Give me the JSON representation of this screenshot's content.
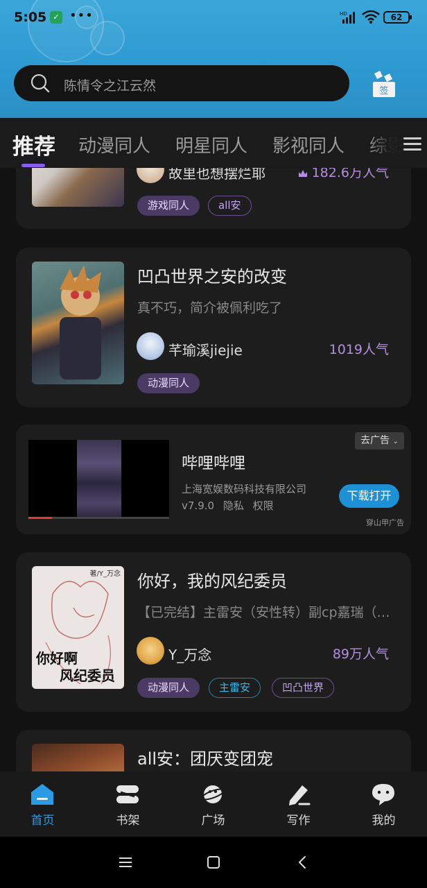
{
  "status_bar": {
    "time": "5:05",
    "dots": "•••",
    "battery": "62",
    "network": "HD"
  },
  "search": {
    "placeholder": "陈情令之江云然"
  },
  "signin": {
    "label": "签"
  },
  "tabs": [
    {
      "label": "推荐"
    },
    {
      "label": "动漫同人"
    },
    {
      "label": "明星同人"
    },
    {
      "label": "影视同人"
    },
    {
      "label": "综影"
    }
  ],
  "cards": [
    {
      "author": "故里也想摆烂耶",
      "popularity": "182.6万人气",
      "tags": [
        "游戏同人",
        "all安"
      ]
    },
    {
      "title": "凹凸世界之安的改变",
      "desc": "真不巧，简介被佩利吃了",
      "author": "芊瑜溪jiejie",
      "popularity": "1019人气",
      "tags": [
        "动漫同人"
      ]
    },
    {
      "title": "你好，我的风纪委员",
      "desc": "【已完结】主雷安（安性转）副cp嘉瑞（瑞…",
      "author": "Y_万念",
      "popularity": "89万人气",
      "tags": [
        "动漫同人",
        "主雷安",
        "凹凸世界"
      ],
      "cover_text": {
        "top": "著/Y_万念",
        "line1": "你好啊",
        "line2": "风纪委员"
      }
    },
    {
      "title": "all安：团厌变团宠"
    }
  ],
  "ad": {
    "title": "哔哩哔哩",
    "company": "上海宽娱数码科技有限公司",
    "version": "v7.9.0",
    "privacy": "隐私",
    "permissions": "权限",
    "go_ad": "去广告",
    "download": "下载打开",
    "source": "穿山甲广告"
  },
  "bottom_nav": [
    {
      "label": "首页",
      "icon": "home-icon",
      "active": true
    },
    {
      "label": "书架",
      "icon": "bookshelf-icon"
    },
    {
      "label": "广场",
      "icon": "planet-icon"
    },
    {
      "label": "写作",
      "icon": "pen-icon"
    },
    {
      "label": "我的",
      "icon": "profile-icon"
    }
  ],
  "colors": {
    "header_blue": "#2d9ad2",
    "accent_purple": "#8a5cf0",
    "active_blue": "#2b9be6",
    "popularity": "#b48ee0",
    "download_button": "#1e90d6"
  }
}
